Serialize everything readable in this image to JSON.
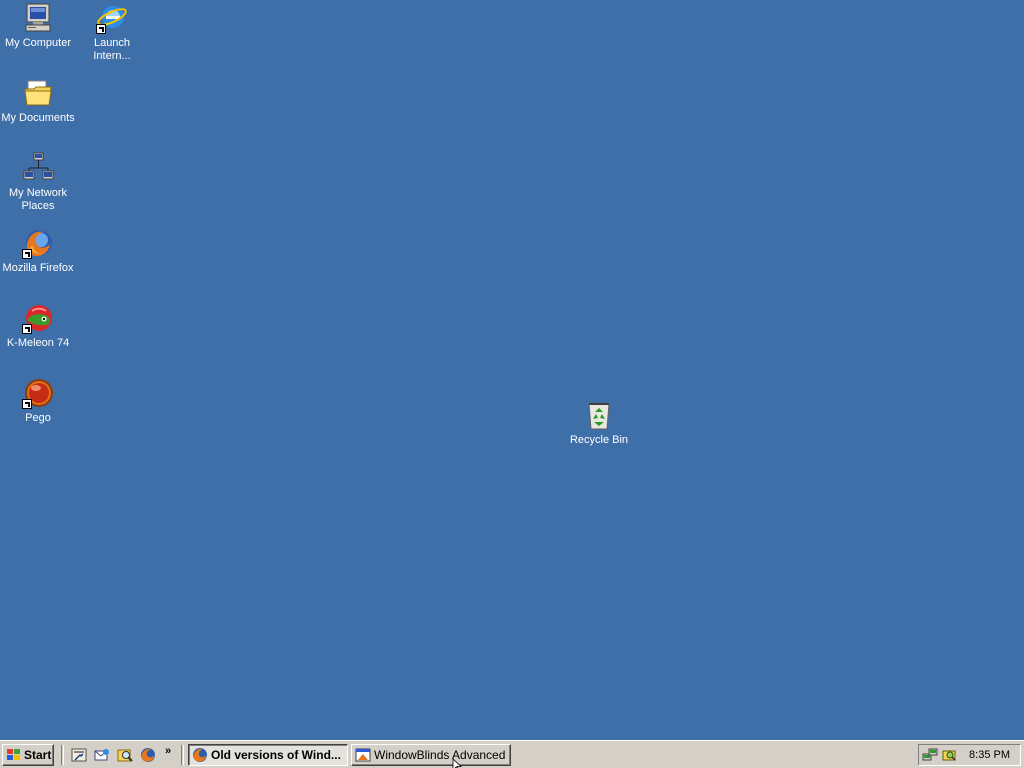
{
  "desktop": {
    "background": "#3f6fa8",
    "icons": [
      {
        "label": "My Computer",
        "icon": "computer-icon",
        "shortcut": false
      },
      {
        "label": "Launch Intern...",
        "icon": "internet-explorer-icon",
        "shortcut": true
      },
      {
        "label": "My Documents",
        "icon": "documents-folder-icon",
        "shortcut": false
      },
      {
        "label": "My Network Places",
        "icon": "network-icon",
        "shortcut": false
      },
      {
        "label": "Mozilla Firefox",
        "icon": "firefox-icon",
        "shortcut": true
      },
      {
        "label": "K-Meleon 74",
        "icon": "k-meleon-icon",
        "shortcut": true
      },
      {
        "label": "Pego",
        "icon": "pego-icon",
        "shortcut": true
      },
      {
        "label": "Recycle Bin",
        "icon": "recycle-bin-icon",
        "shortcut": false
      }
    ]
  },
  "taskbar": {
    "start_label": "Start",
    "quick_launch": [
      {
        "icon": "show-desktop-icon"
      },
      {
        "icon": "outlook-express-icon"
      },
      {
        "icon": "search-icon"
      },
      {
        "icon": "firefox-icon"
      }
    ],
    "overflow_label": "»",
    "tasks": [
      {
        "label": "Old versions of Wind...",
        "icon": "firefox-icon",
        "active": true
      },
      {
        "label": "WindowBlinds Advanced ...",
        "icon": "windowblinds-icon",
        "active": false
      }
    ],
    "tray": {
      "icons": [
        "network-tray-icon",
        "security-tray-icon"
      ],
      "clock": "8:35 PM"
    }
  }
}
